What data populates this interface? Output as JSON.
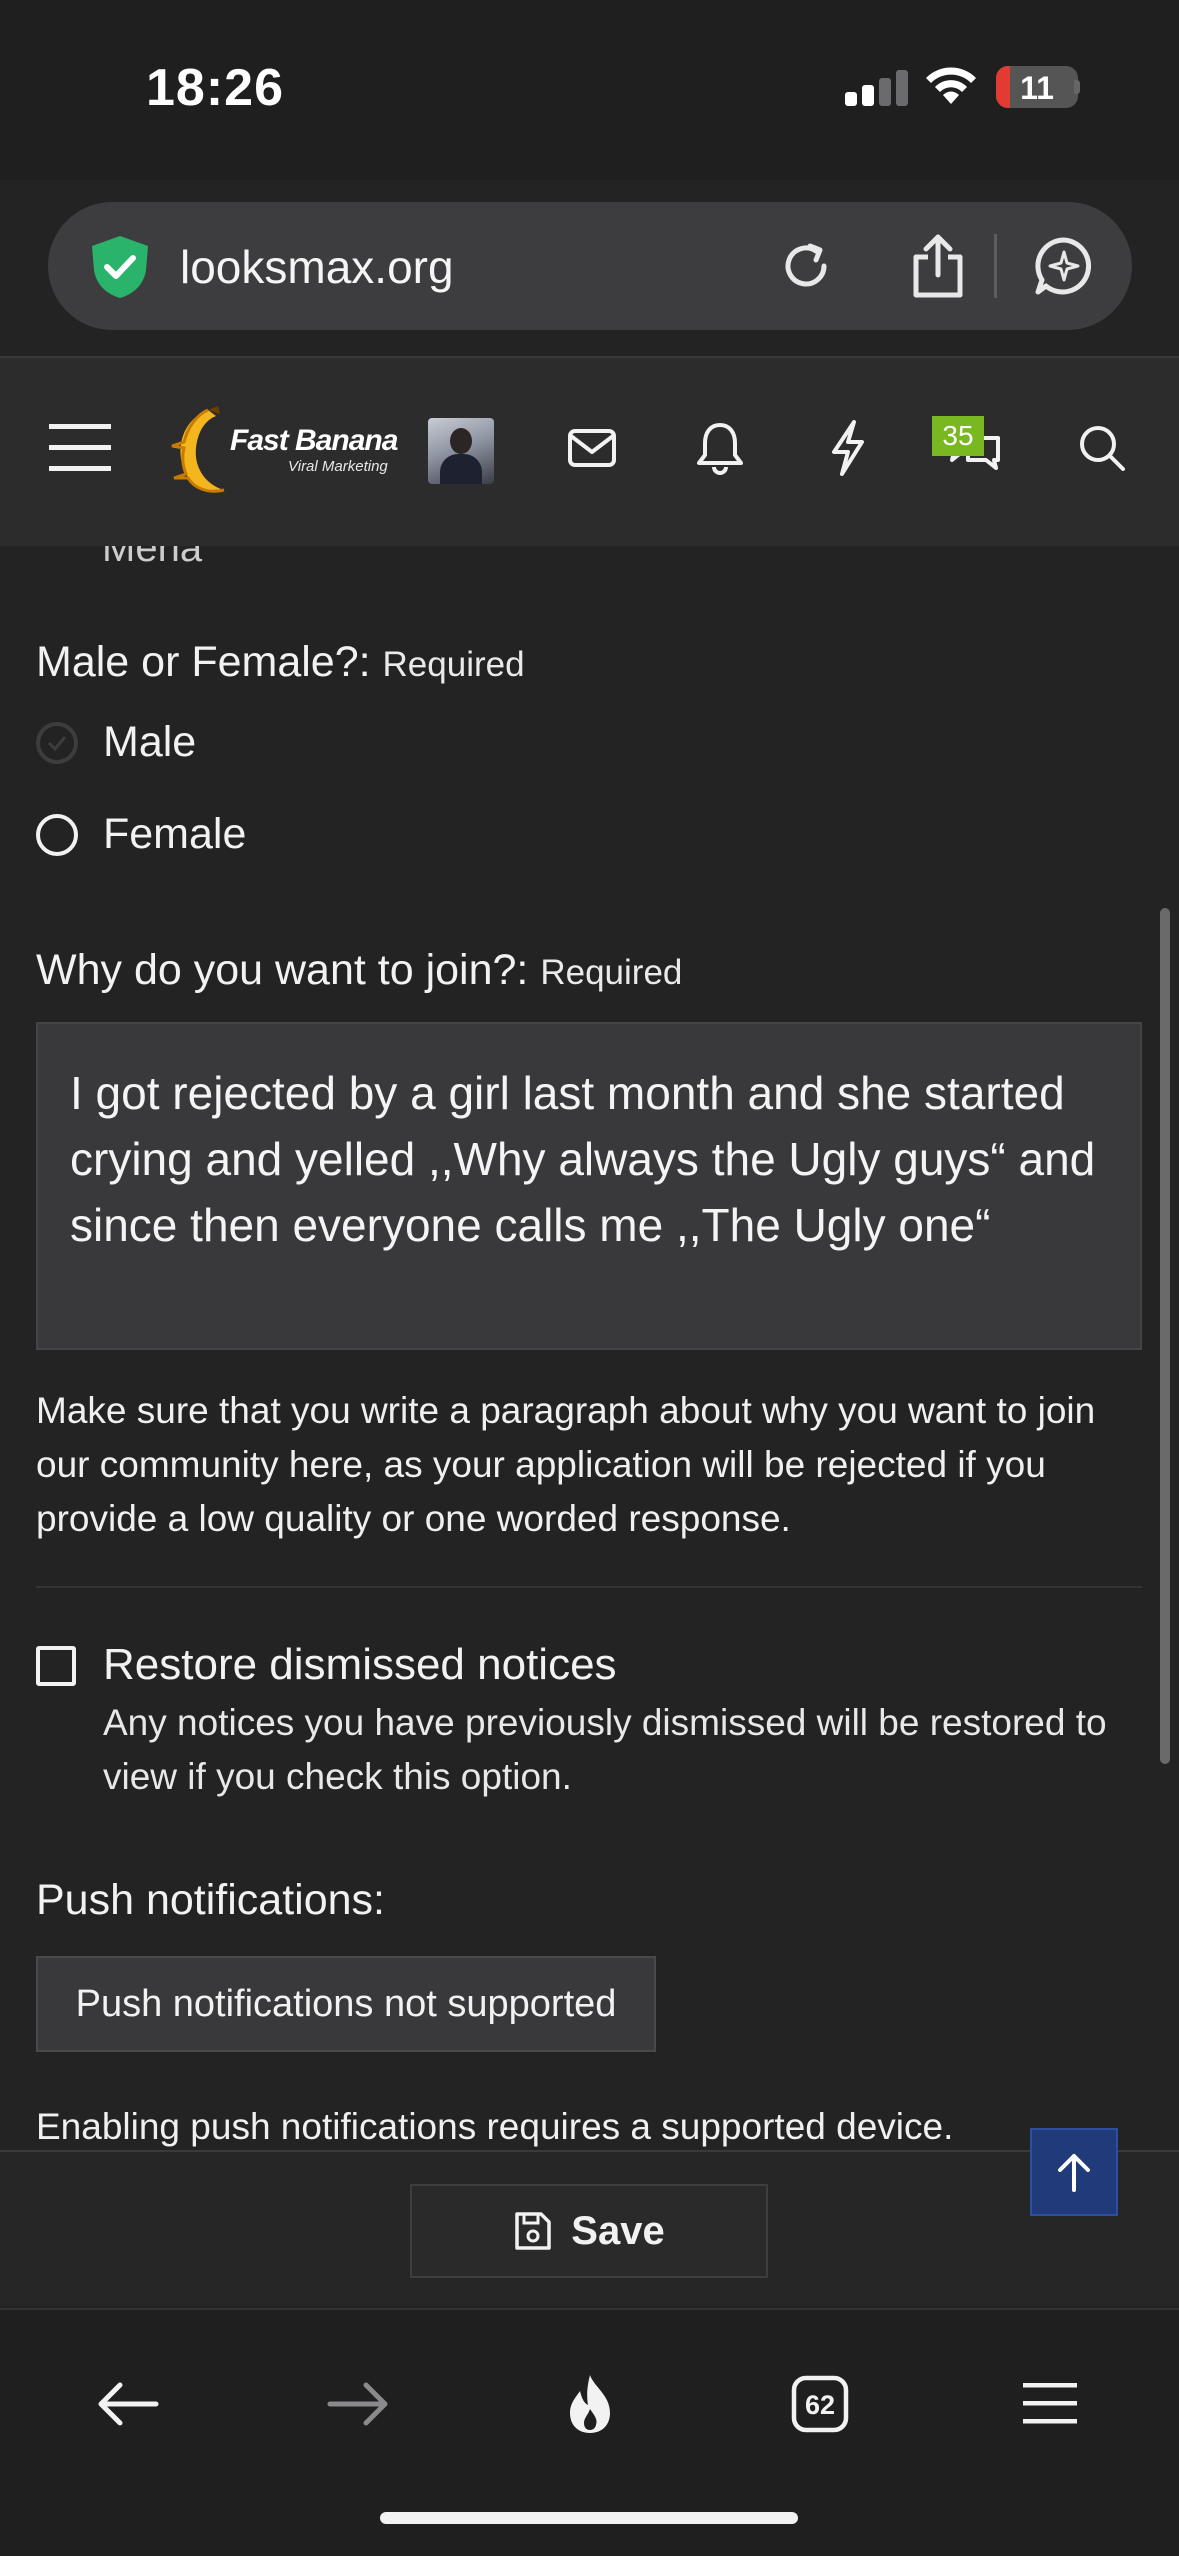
{
  "status_bar": {
    "time": "18:26",
    "battery_level": "11",
    "icons": [
      "signal-icon",
      "wifi-icon",
      "battery-icon"
    ]
  },
  "browser": {
    "url": "looksmax.org",
    "buttons": [
      "reload-icon",
      "share-icon",
      "ai-assistant-icon"
    ],
    "toolbar": [
      "back-icon",
      "forward-icon",
      "flame-icon",
      "tabs-icon",
      "menu-icon"
    ],
    "tab_count": "62"
  },
  "site_header": {
    "logo_title": "Fast Banana",
    "logo_subtitle": "Viral Marketing",
    "conversations_badge": "35",
    "icons": [
      "hamburger-icon",
      "mail-icon",
      "bell-icon",
      "lightning-icon",
      "chat-icon",
      "search-icon"
    ]
  },
  "form": {
    "cut_off_text": "Mena",
    "gender": {
      "label": "Male or Female?:",
      "required": "Required",
      "options": [
        "Male",
        "Female"
      ]
    },
    "why_join": {
      "label": "Why do you want to join?:",
      "required": "Required",
      "value": "I got rejected by a girl last month and she started crying and yelled ,,Why always the Ugly guys“ and since then everyone calls me ,,The Ugly one“",
      "hint": "Make sure that you write a paragraph about why you want to join our community here, as your application will be rejected if you provide a low quality or one worded response."
    },
    "restore_notices": {
      "label": "Restore dismissed notices",
      "hint": "Any notices you have previously dismissed will be restored to view if you check this option."
    },
    "push": {
      "label": "Push notifications:",
      "button": "Push notifications not supported",
      "hint": "Enabling push notifications requires a supported device."
    },
    "save_label": "Save"
  },
  "colors": {
    "background": "#232324",
    "header": "#2c2c2d",
    "badge": "#7ab822",
    "scroll_top": "#203a7a"
  }
}
